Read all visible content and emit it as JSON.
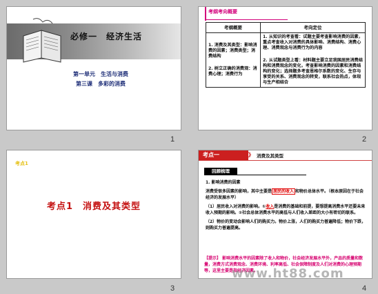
{
  "slides": [
    {
      "number": "1",
      "title": "必修一　经济生活",
      "sub1": "第一单元　生活与消费",
      "sub2": "第三课　多彩的消费"
    },
    {
      "number": "2",
      "heading": "考纲考向概要",
      "table": {
        "col1": "考纲概要",
        "col2": "考向定位",
        "left": [
          "1. 消费及其类型：影响消费的因素；消费类型；消费结构",
          "2. 树立正确的消费观：消费心理；消费行为"
        ],
        "right": [
          "1. 从知识的考查看：试题主要考查影响消费的因素，重点考查收入对消费的具体影响、消费结构、消费心理、消费观念与消费行为的内容",
          "2. 从试题类型上看：材料题主要立足我国居民消费结构和消费观念的变化，考查影响消费的因素和消费结构的变化；选择题多考查恩格尔系数的变化、生存与享受的关系、消费观念的转变，联系社会热点，体现与生产相结合"
        ]
      }
    },
    {
      "number": "3",
      "tag": "考点1",
      "big_title": "考点1　消费及其类型"
    },
    {
      "number": "4",
      "badge": "考点一",
      "chev": "》",
      "top_title": "消费及其类型",
      "label": "回顾梳理",
      "p1": "1. 影响消费的因素",
      "p2a": "消费受很多因素的影响，其中主要是",
      "p2b": "居民的收入",
      "p2c": "和物价总体水平。（根本原因在于社会经济的发展水平）",
      "p3a": "（1）居民收入对消费的影响。①",
      "p3b": "收入",
      "p3c": "是消费的基础和前提，要想提高消费水平还要未来收入预期的影响。②社会总体消费水平的高低与人们收入差距的大小有密切的联系。",
      "p4": "（2）物价的变动会影响人们的购买力。物价上涨，人们的购买力普遍降低；物价下跌，则购买力普遍提高。",
      "tip": "【提示】 影响消费水平的因素除了收入和物价，社会经济发展水平外，产品的质量和数量，消费方式消费观念、消费环境、利率高低、社会保障制度及人们对消费的心理预期等，这里主要是指经济因素。"
    }
  ],
  "watermark": "www.ht88.com"
}
